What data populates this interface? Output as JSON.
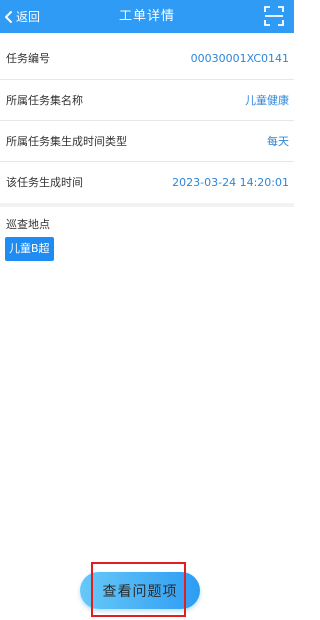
{
  "header": {
    "back_label": "返回",
    "title": "工单详情",
    "back_icon": "chevron-left-icon",
    "scan_icon": "scan-icon"
  },
  "rows": [
    {
      "label": "任务编号",
      "value": "00030001XC0141"
    },
    {
      "label": "所属任务集名称",
      "value": "儿童健康"
    },
    {
      "label": "所属任务集生成时间类型",
      "value": "每天"
    },
    {
      "label": "该任务生成时间",
      "value": "2023-03-24 14:20:01"
    }
  ],
  "patrol": {
    "title": "巡查地点",
    "locations": [
      "儿童B超"
    ]
  },
  "footer": {
    "button_label": "查看问题项"
  },
  "colors": {
    "header_bg": "#2f9bf4",
    "value_text": "#2f86d8",
    "tag_bg": "#1e8cf2",
    "highlight": "#e02020"
  }
}
